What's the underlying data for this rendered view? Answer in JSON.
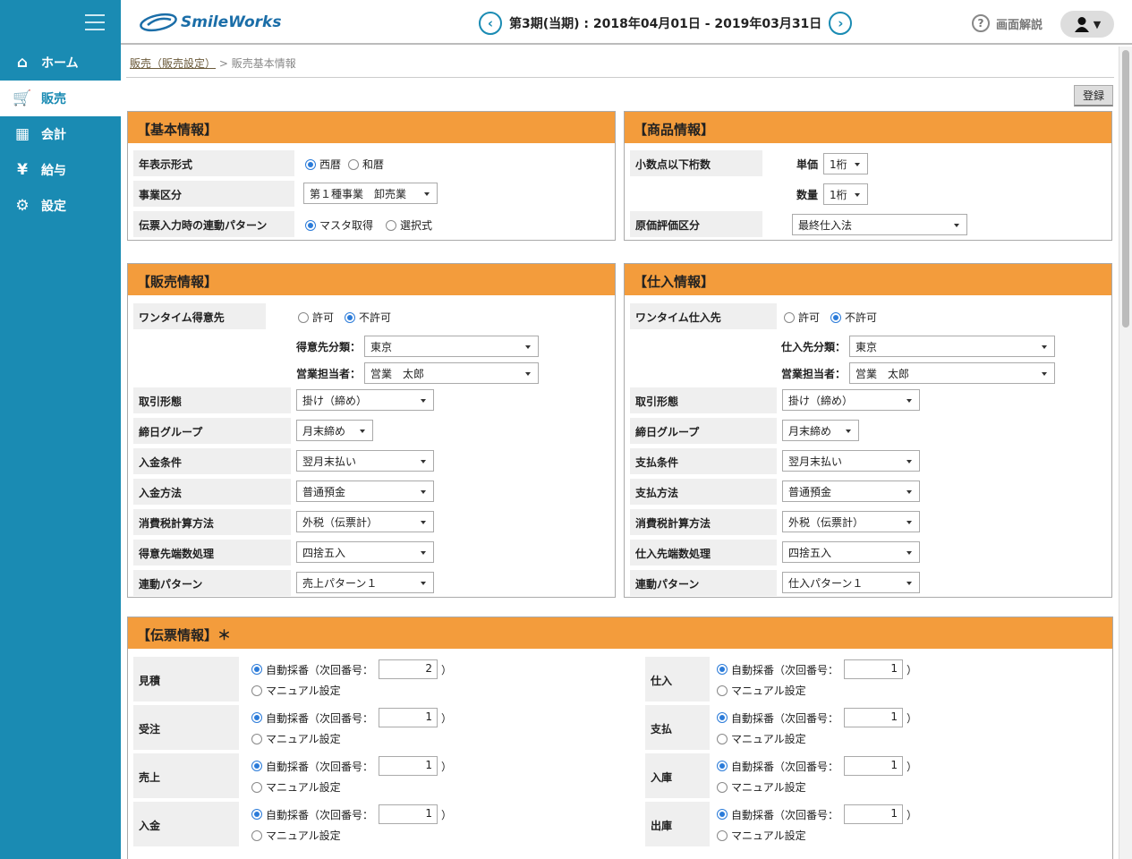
{
  "header": {
    "logo_text": "SmileWorks",
    "prev_icon": "chevron-left-icon",
    "next_icon": "chevron-right-icon",
    "period": "第3期(当期) : 2018年04月01日 - 2019年03月31日",
    "help_label": "画面解説",
    "help_icon": "question-icon",
    "user_icon": "user-icon",
    "user_caret": "▼"
  },
  "sidebar": {
    "items": [
      {
        "label": "ホーム",
        "icon": "home-icon"
      },
      {
        "label": "販売",
        "icon": "cart-icon"
      },
      {
        "label": "会計",
        "icon": "calculator-icon"
      },
      {
        "label": "給与",
        "icon": "yen-bag-icon"
      },
      {
        "label": "設定",
        "icon": "gear-icon"
      }
    ]
  },
  "breadcrumb": {
    "link": "販売（販売設定）",
    "sep": ">",
    "current": "販売基本情報"
  },
  "register_label": "登録",
  "basic": {
    "title": "【基本情報】",
    "year_label": "年表示形式",
    "year_opt1": "西暦",
    "year_opt2": "和暦",
    "biz_label": "事業区分",
    "biz_value": "第１種事業　卸売業",
    "link_label": "伝票入力時の連動パターン",
    "link_opt1": "マスタ取得",
    "link_opt2": "選択式"
  },
  "product": {
    "title": "【商品情報】",
    "decimal_label": "小数点以下桁数",
    "unit_label": "単価",
    "unit_value": "1桁",
    "qty_label": "数量",
    "qty_value": "1桁",
    "cost_label": "原価評価区分",
    "cost_value": "最終仕入法"
  },
  "sales": {
    "title": "【販売情報】",
    "onetime_label": "ワンタイム得意先",
    "opt_allow": "許可",
    "opt_deny": "不許可",
    "class_label": "得意先分類：",
    "class_value": "東京",
    "staff_label": "営業担当者：",
    "staff_value": "営業　太郎",
    "rows": [
      {
        "label": "取引形態",
        "value": "掛け（締め）"
      },
      {
        "label": "締日グループ",
        "value": "月末締め"
      },
      {
        "label": "入金条件",
        "value": "翌月末払い"
      },
      {
        "label": "入金方法",
        "value": "普通預金"
      },
      {
        "label": "消費税計算方法",
        "value": "外税（伝票計）"
      },
      {
        "label": "得意先端数処理",
        "value": "四捨五入"
      },
      {
        "label": "連動パターン",
        "value": "売上パターン１"
      }
    ]
  },
  "purchase": {
    "title": "【仕入情報】",
    "onetime_label": "ワンタイム仕入先",
    "opt_allow": "許可",
    "opt_deny": "不許可",
    "class_label": "仕入先分類：",
    "class_value": "東京",
    "staff_label": "営業担当者：",
    "staff_value": "営業　太郎",
    "rows": [
      {
        "label": "取引形態",
        "value": "掛け（締め）"
      },
      {
        "label": "締日グループ",
        "value": "月末締め"
      },
      {
        "label": "支払条件",
        "value": "翌月末払い"
      },
      {
        "label": "支払方法",
        "value": "普通預金"
      },
      {
        "label": "消費税計算方法",
        "value": "外税（伝票計）"
      },
      {
        "label": "仕入先端数処理",
        "value": "四捨五入"
      },
      {
        "label": "連動パターン",
        "value": "仕入パターン１"
      }
    ]
  },
  "voucher": {
    "title": "【伝票情報】＊",
    "auto_label": "自動採番（次回番号：",
    "close_paren": "）",
    "manual_label": "マニュアル設定",
    "left": [
      {
        "label": "見積",
        "num": "2"
      },
      {
        "label": "受注",
        "num": "1"
      },
      {
        "label": "売上",
        "num": "1"
      },
      {
        "label": "入金",
        "num": "1"
      }
    ],
    "right": [
      {
        "label": "仕入",
        "num": "1"
      },
      {
        "label": "支払",
        "num": "1"
      },
      {
        "label": "入庫",
        "num": "1"
      },
      {
        "label": "出庫",
        "num": "1"
      }
    ]
  }
}
